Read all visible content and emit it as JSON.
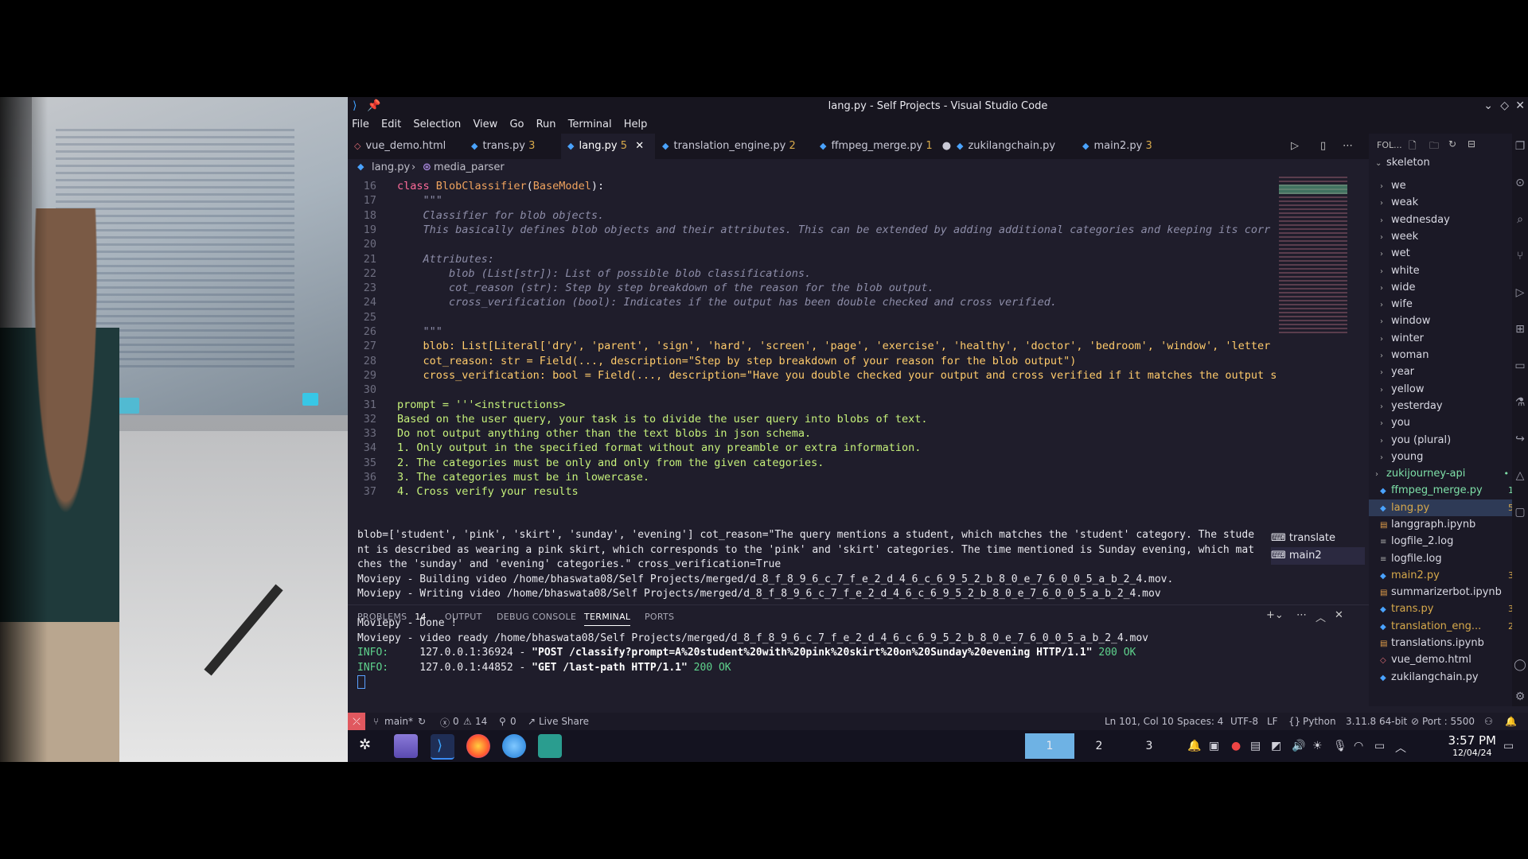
{
  "window": {
    "title": "lang.py - Self Projects - Visual Studio Code"
  },
  "menu": [
    "File",
    "Edit",
    "Selection",
    "View",
    "Go",
    "Run",
    "Terminal",
    "Help"
  ],
  "tabs": [
    {
      "name": "vue_demo.html",
      "badge": "",
      "icon": "html-icon"
    },
    {
      "name": "trans.py",
      "badge": "3",
      "icon": "python-icon"
    },
    {
      "name": "lang.py",
      "badge": "5",
      "icon": "python-icon",
      "active": true
    },
    {
      "name": "translation_engine.py",
      "badge": "2",
      "icon": "python-icon"
    },
    {
      "name": "ffmpeg_merge.py",
      "badge": "1",
      "icon": "python-icon",
      "modified": true
    },
    {
      "name": "zukilangchain.py",
      "badge": "",
      "icon": "python-icon"
    },
    {
      "name": "main2.py",
      "badge": "3",
      "icon": "python-icon"
    }
  ],
  "breadcrumb": {
    "file": "lang.py",
    "symbol": "media_parser"
  },
  "editor_lines": [
    {
      "n": "16",
      "t": "class BlobClassifier(BaseModel):"
    },
    {
      "n": "17",
      "t": "    \"\"\""
    },
    {
      "n": "18",
      "t": "    Classifier for blob objects."
    },
    {
      "n": "19",
      "t": "    This basically defines blob objects and their attributes. This can be extended by adding additional categories and keeping its corr"
    },
    {
      "n": "20",
      "t": ""
    },
    {
      "n": "21",
      "t": "    Attributes:"
    },
    {
      "n": "22",
      "t": "        blob (List[str]): List of possible blob classifications."
    },
    {
      "n": "23",
      "t": "        cot_reason (str): Step by step breakdown of the reason for the blob output."
    },
    {
      "n": "24",
      "t": "        cross_verification (bool): Indicates if the output has been double checked and cross verified."
    },
    {
      "n": "25",
      "t": ""
    },
    {
      "n": "26",
      "t": "    \"\"\""
    },
    {
      "n": "27",
      "t": "    blob: List[Literal['dry', 'parent', 'sign', 'hard', 'screen', 'page', 'exercise', 'healthy', 'doctor', 'bedroom', 'window', 'letter"
    },
    {
      "n": "28",
      "t": "    cot_reason: str = Field(..., description=\"Step by step breakdown of your reason for the blob output\")"
    },
    {
      "n": "29",
      "t": "    cross_verification: bool = Field(..., description=\"Have you double checked your output and cross verified if it matches the output s"
    },
    {
      "n": "30",
      "t": ""
    },
    {
      "n": "31",
      "t": "prompt = '''<instructions>"
    },
    {
      "n": "32",
      "t": "Based on the user query, your task is to divide the user query into blobs of text."
    },
    {
      "n": "33",
      "t": "Do not output anything other than the text blobs in json schema."
    },
    {
      "n": "34",
      "t": "1. Only output in the specified format without any preamble or extra information."
    },
    {
      "n": "35",
      "t": "2. The categories must be only and only from the given categories."
    },
    {
      "n": "36",
      "t": "3. The categories must be in lowercase."
    },
    {
      "n": "37",
      "t": "4. Cross verify your results"
    }
  ],
  "explorer": {
    "header": "FOL...",
    "root": "skeleton",
    "folders": [
      "we",
      "weak",
      "wednesday",
      "week",
      "wet",
      "white",
      "wide",
      "wife",
      "window",
      "winter",
      "woman",
      "year",
      "yellow",
      "yesterday",
      "you",
      "you (plural)",
      "young"
    ],
    "items": [
      {
        "name": "zukijourney-api",
        "badge": "•",
        "type": "folder"
      },
      {
        "name": "ffmpeg_merge.py",
        "badge": "1",
        "type": "py"
      },
      {
        "name": "lang.py",
        "badge": "5",
        "type": "py",
        "active": true
      },
      {
        "name": "langgraph.ipynb",
        "badge": "",
        "type": "nb"
      },
      {
        "name": "logfile_2.log",
        "badge": "",
        "type": "log"
      },
      {
        "name": "logfile.log",
        "badge": "",
        "type": "log"
      },
      {
        "name": "main2.py",
        "badge": "3",
        "type": "py"
      },
      {
        "name": "summarizerbot.ipynb",
        "badge": "",
        "type": "nb"
      },
      {
        "name": "trans.py",
        "badge": "3",
        "type": "py"
      },
      {
        "name": "translation_eng...",
        "badge": "2",
        "type": "py"
      },
      {
        "name": "translations.ipynb",
        "badge": "",
        "type": "nb"
      },
      {
        "name": "vue_demo.html",
        "badge": "",
        "type": "html"
      },
      {
        "name": "zukilangchain.py",
        "badge": "",
        "type": "py"
      }
    ]
  },
  "panel": {
    "tabs": [
      {
        "label": "PROBLEMS",
        "count": "14"
      },
      {
        "label": "OUTPUT"
      },
      {
        "label": "DEBUG CONSOLE"
      },
      {
        "label": "TERMINAL",
        "active": true
      },
      {
        "label": "PORTS"
      }
    ],
    "terminals": [
      "translate",
      "main2"
    ],
    "lines": [
      "blob=['student', 'pink', 'skirt', 'sunday', 'evening'] cot_reason=\"The query mentions a student, which matches the 'student' category. The stude",
      "nt is described as wearing a pink skirt, which corresponds to the 'pink' and 'skirt' categories. The time mentioned is Sunday evening, which mat",
      "ches the 'sunday' and 'evening' categories.\" cross_verification=True",
      "Moviepy - Building video /home/bhaswata08/Self Projects/merged/d_8_f_8_9_6_c_7_f_e_2_d_4_6_c_6_9_5_2_b_8_0_e_7_6_0_0_5_a_b_2_4.mov.",
      "Moviepy - Writing video /home/bhaswata08/Self Projects/merged/d_8_f_8_9_6_c_7_f_e_2_d_4_6_c_6_9_5_2_b_8_0_e_7_6_0_0_5_a_b_2_4.mov",
      "",
      "Moviepy - Done !",
      "Moviepy - video ready /home/bhaswata08/Self Projects/merged/d_8_f_8_9_6_c_7_f_e_2_d_4_6_c_6_9_5_2_b_8_0_e_7_6_0_0_5_a_b_2_4.mov"
    ],
    "info1": {
      "prefix": "INFO:",
      "addr": "127.0.0.1:36924 - ",
      "req": "\"POST /classify?prompt=A%20student%20with%20pink%20skirt%20on%20Sunday%20evening HTTP/1.1\"",
      "status": "200 OK"
    },
    "info2": {
      "prefix": "INFO:",
      "addr": "127.0.0.1:44852 - ",
      "req": "\"GET /last-path HTTP/1.1\"",
      "status": "200 OK"
    }
  },
  "status": {
    "branch": "main*",
    "errors": "0",
    "warnings": "14",
    "ports": "0",
    "live": "Live Share",
    "pos": "Ln 101, Col 10",
    "spaces": "Spaces: 4",
    "enc": "UTF-8",
    "eol": "LF",
    "lang": "Python",
    "interp": "3.11.8 64-bit",
    "port": "Port : 5500"
  },
  "taskbar": {
    "workspaces": [
      "1",
      "2",
      "3"
    ],
    "time": "3:57 PM",
    "date": "12/04/24"
  }
}
